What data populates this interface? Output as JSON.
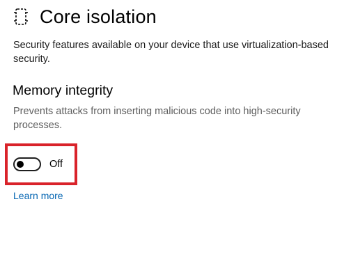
{
  "header": {
    "icon": "core-isolation-chip-icon",
    "title": "Core isolation"
  },
  "description": "Security features available on your device that use virtualization-based security.",
  "memory_integrity": {
    "title": "Memory integrity",
    "description": "Prevents attacks from inserting malicious code into high-security processes.",
    "toggle_state": "Off",
    "toggle_on": false
  },
  "links": {
    "learn_more": "Learn more"
  },
  "colors": {
    "highlight": "#d9232a",
    "link": "#0063b1",
    "secondary_text": "#5d5d5d"
  }
}
